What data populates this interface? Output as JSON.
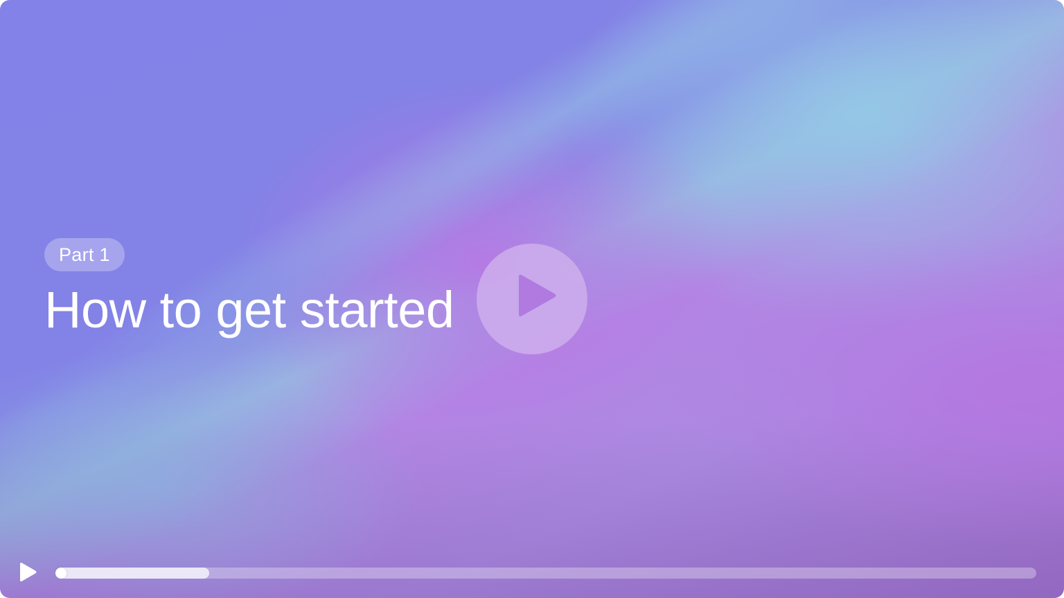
{
  "video": {
    "badge": "Part 1",
    "title": "How to get started"
  },
  "playback": {
    "progress_fraction": 0.157,
    "big_play_icon": "play-icon",
    "control_play_icon": "play-icon"
  },
  "colors": {
    "accent_purple": "#b27de4",
    "accent_blue": "#8382e8",
    "accent_sky": "#94c6e4",
    "icon_play_fill": "#b07ae0",
    "text": "#ffffff"
  }
}
